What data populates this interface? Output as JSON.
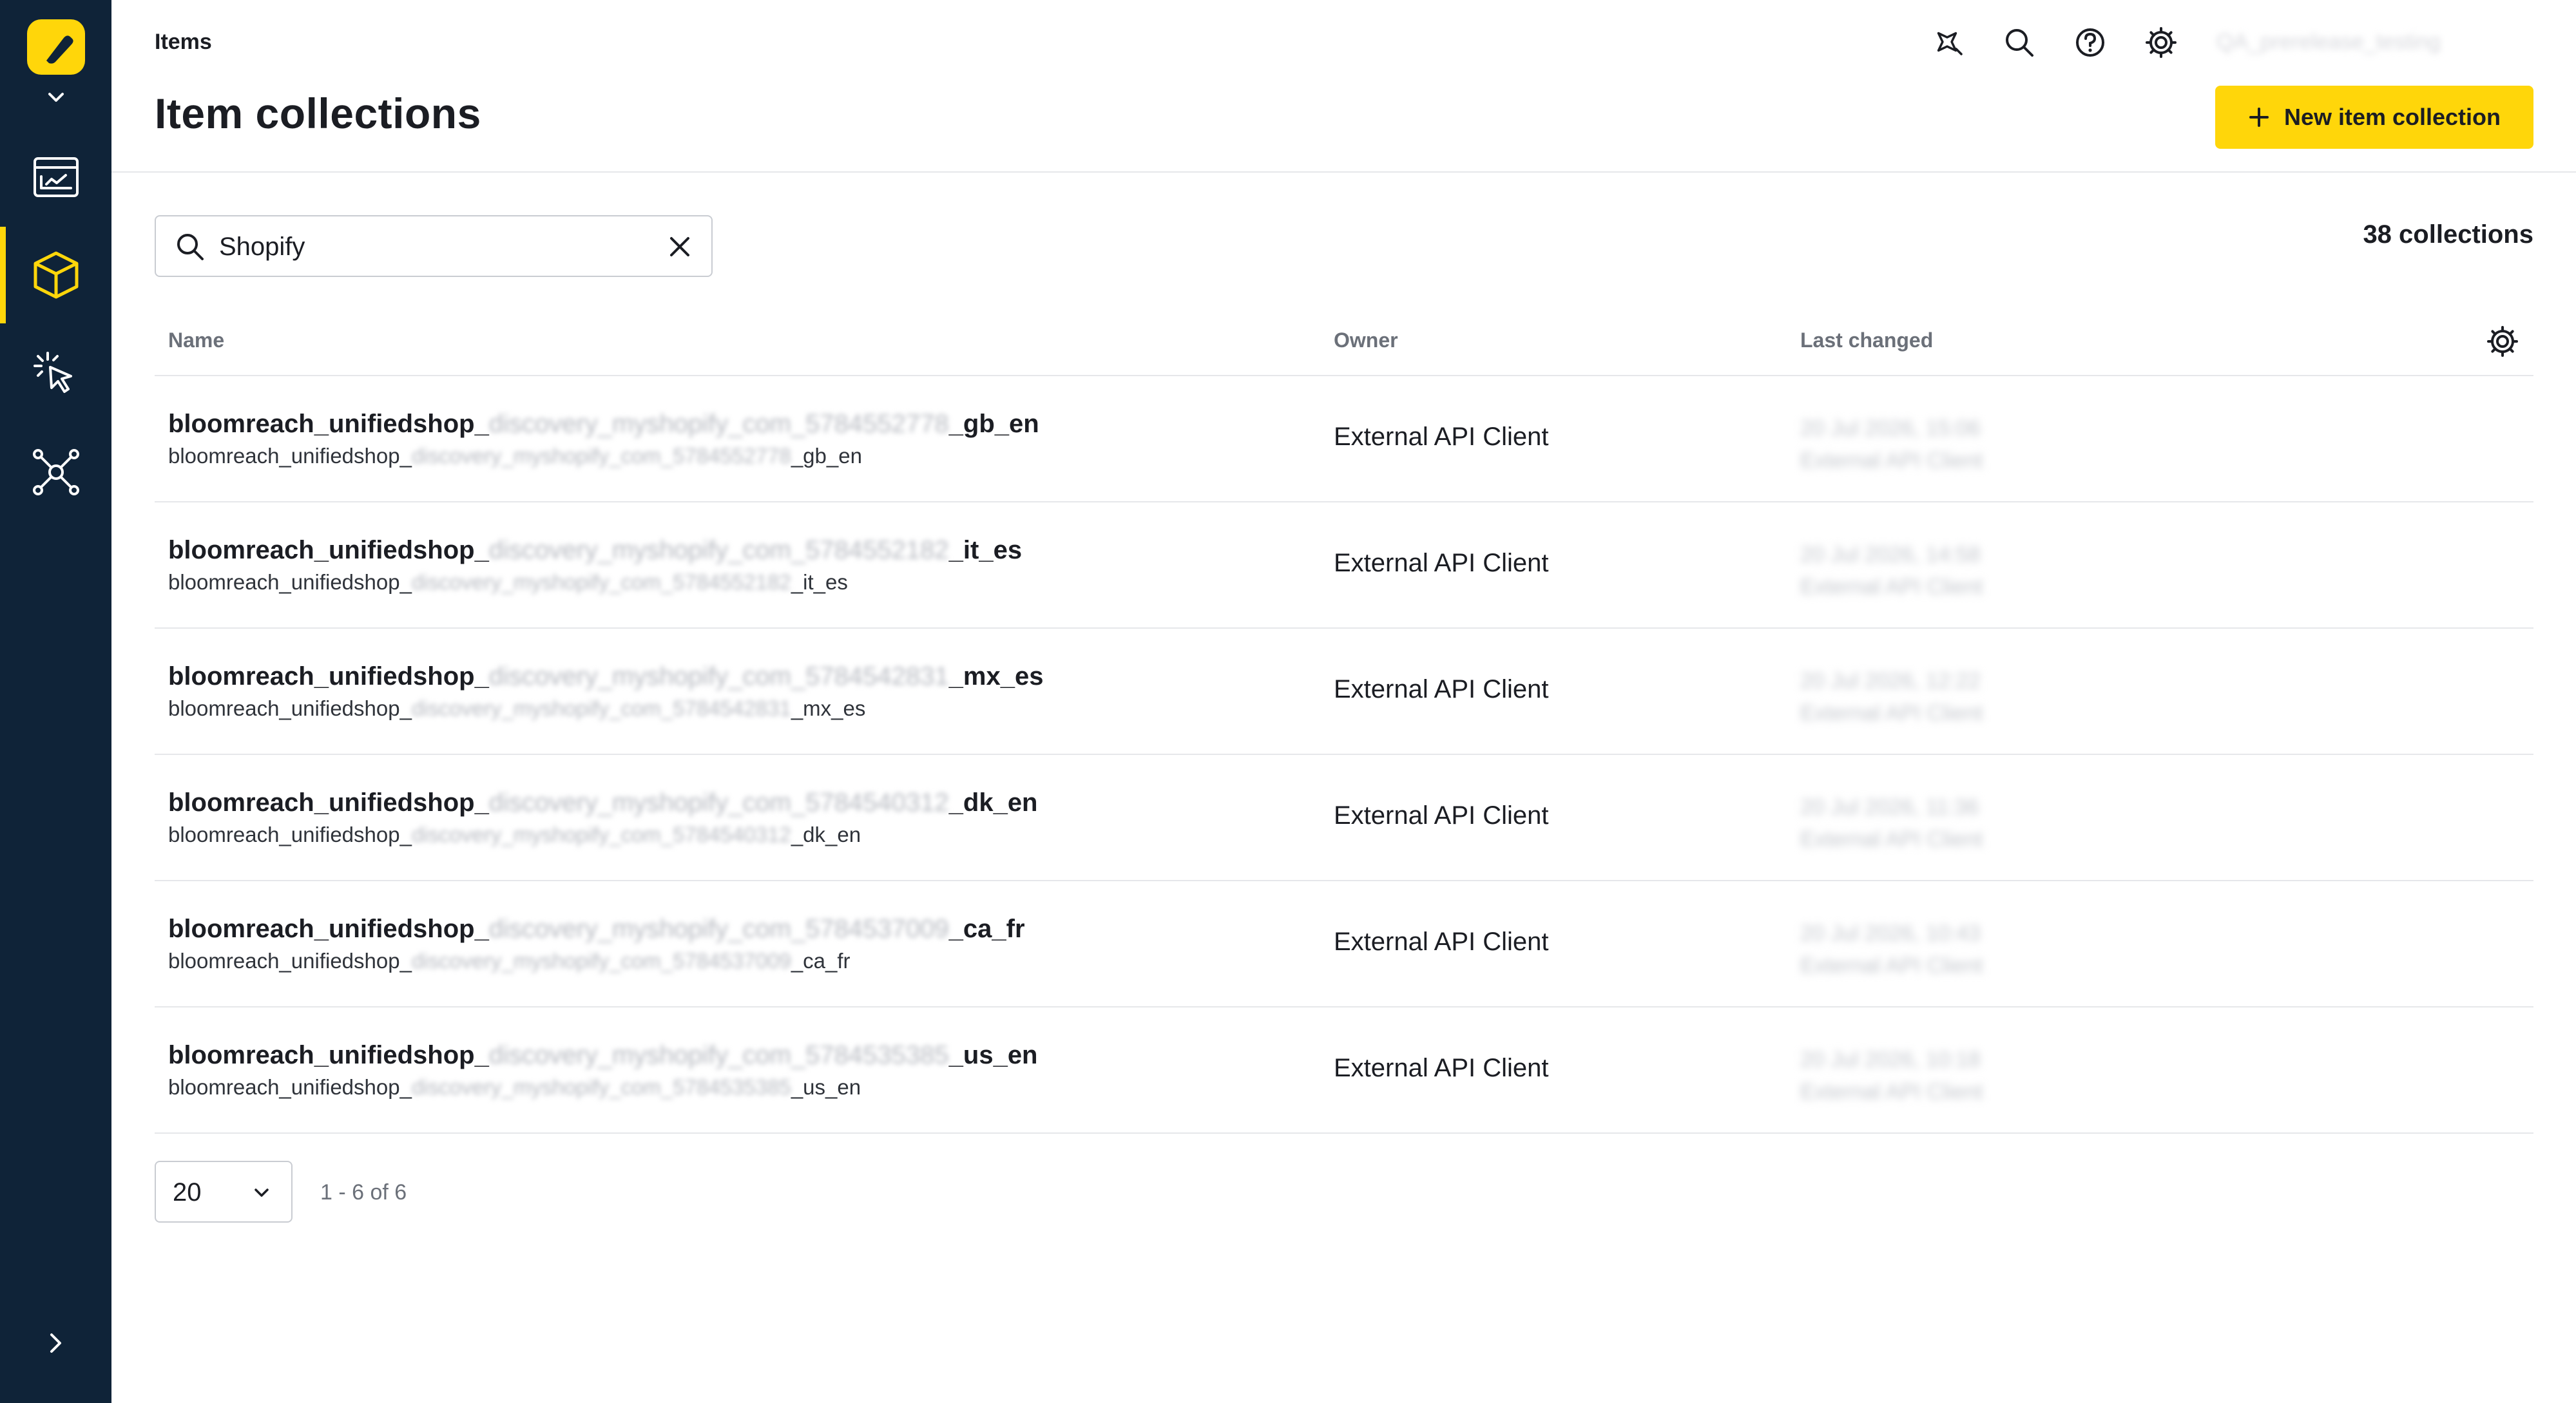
{
  "header": {
    "breadcrumb": "Items",
    "title": "Item collections",
    "user": "QA_prerelease_testing",
    "new_button_label": "New item collection"
  },
  "search": {
    "value": "Shopify",
    "placeholder": ""
  },
  "summary": {
    "count_label": "38 collections"
  },
  "table": {
    "columns": [
      "Name",
      "Owner",
      "Last changed"
    ],
    "rows": [
      {
        "name_prefix": "bloomreach_unifiedshop_",
        "name_hidden": "discovery_myshopify_com_5784552778",
        "name_suffix": "_gb_en",
        "id_prefix": "bloomreach_unifiedshop_",
        "id_hidden": "discovery_myshopify_com_5784552778",
        "id_suffix": "_gb_en",
        "owner": "External API Client",
        "changed_date": "20 Jul 2026, 15:06",
        "changed_by": "External API Client"
      },
      {
        "name_prefix": "bloomreach_unifiedshop_",
        "name_hidden": "discovery_myshopify_com_5784552182",
        "name_suffix": "_it_es",
        "id_prefix": "bloomreach_unifiedshop_",
        "id_hidden": "discovery_myshopify_com_5784552182",
        "id_suffix": "_it_es",
        "owner": "External API Client",
        "changed_date": "20 Jul 2026, 14:58",
        "changed_by": "External API Client"
      },
      {
        "name_prefix": "bloomreach_unifiedshop_",
        "name_hidden": "discovery_myshopify_com_5784542831",
        "name_suffix": "_mx_es",
        "id_prefix": "bloomreach_unifiedshop_",
        "id_hidden": "discovery_myshopify_com_5784542831",
        "id_suffix": "_mx_es",
        "owner": "External API Client",
        "changed_date": "20 Jul 2026, 12:22",
        "changed_by": "External API Client"
      },
      {
        "name_prefix": "bloomreach_unifiedshop_",
        "name_hidden": "discovery_myshopify_com_5784540312",
        "name_suffix": "_dk_en",
        "id_prefix": "bloomreach_unifiedshop_",
        "id_hidden": "discovery_myshopify_com_5784540312",
        "id_suffix": "_dk_en",
        "owner": "External API Client",
        "changed_date": "20 Jul 2026, 11:36",
        "changed_by": "External API Client"
      },
      {
        "name_prefix": "bloomreach_unifiedshop_",
        "name_hidden": "discovery_myshopify_com_5784537009",
        "name_suffix": "_ca_fr",
        "id_prefix": "bloomreach_unifiedshop_",
        "id_hidden": "discovery_myshopify_com_5784537009",
        "id_suffix": "_ca_fr",
        "owner": "External API Client",
        "changed_date": "20 Jul 2026, 10:43",
        "changed_by": "External API Client"
      },
      {
        "name_prefix": "bloomreach_unifiedshop_",
        "name_hidden": "discovery_myshopify_com_5784535385",
        "name_suffix": "_us_en",
        "id_prefix": "bloomreach_unifiedshop_",
        "id_hidden": "discovery_myshopify_com_5784535385",
        "id_suffix": "_us_en",
        "owner": "External API Client",
        "changed_date": "20 Jul 2026, 10:18",
        "changed_by": "External API Client"
      }
    ]
  },
  "pagination": {
    "page_size": "20",
    "range": "1 - 6 of 6"
  },
  "icons": {
    "logo": "bloomreach-logo-icon",
    "nav": [
      "dashboard-icon",
      "cube-icon",
      "cursor-click-icon",
      "network-icon"
    ],
    "header": [
      "ai-sparkle-icon",
      "search-icon",
      "help-icon",
      "gear-icon"
    ]
  },
  "colors": {
    "sidebar_bg": "#0f2338",
    "accent": "#ffd60a",
    "text": "#1b1d23",
    "muted": "#6b7079",
    "divider": "#e6e7ea"
  }
}
